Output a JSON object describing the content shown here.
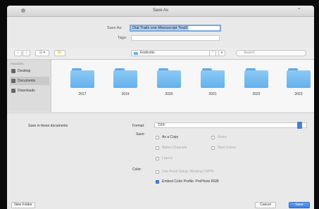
{
  "window": {
    "title": "Save As"
  },
  "save_as": {
    "label": "Save As:",
    "value": "Dial Trails one-Manuscript Test3"
  },
  "tags": {
    "label": "Tags:",
    "value": ""
  },
  "toolbar": {
    "back": "‹",
    "forward": "›",
    "view": "☷ ▾",
    "new_folder": "📁",
    "location": "Endicotts",
    "location_stepper": "⌃",
    "expand": "▾",
    "search_placeholder": "Search"
  },
  "sidebar": {
    "header": "Favorites",
    "items": [
      {
        "label": "Desktop",
        "icon": "desktop-icon"
      },
      {
        "label": "Documents",
        "icon": "documents-icon"
      },
      {
        "label": "Downloads",
        "icon": "downloads-icon"
      }
    ]
  },
  "folders": [
    {
      "name": "2017"
    },
    {
      "name": "2019"
    },
    {
      "name": "2020"
    },
    {
      "name": "2021"
    },
    {
      "name": "2022"
    },
    {
      "name": "2023"
    }
  ],
  "options": {
    "hide_ext_label": "Save in these documents",
    "format_label": "Format:",
    "format_value": "TIFF",
    "save_label": "Save:",
    "as_copy": "As a Copy",
    "notes": "Notes",
    "alpha": "Alpha Channels",
    "spot": "Spot Colors",
    "layers": "Layers",
    "color_label": "Color:",
    "use_proof": "Use Proof Setup:  Working CMYK",
    "embed_profile": "Embed Color Profile:  ProPhoto RGB"
  },
  "buttons": {
    "new_folder": "New Folder",
    "cancel": "Cancel",
    "save": "Save"
  }
}
